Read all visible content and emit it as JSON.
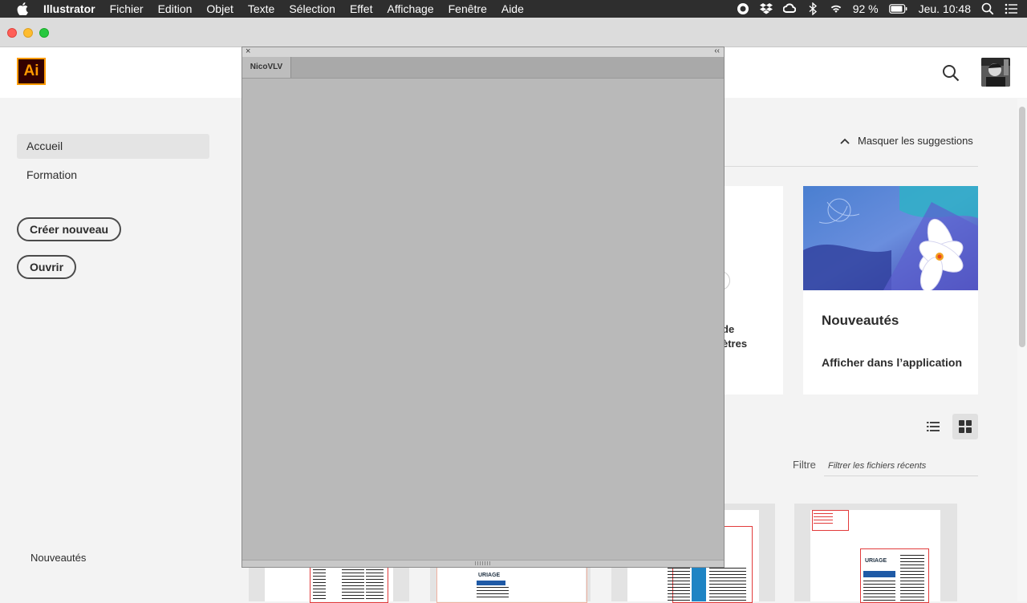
{
  "menubar": {
    "app": "Illustrator",
    "items": [
      "Fichier",
      "Edition",
      "Objet",
      "Texte",
      "Sélection",
      "Effet",
      "Affichage",
      "Fenêtre",
      "Aide"
    ],
    "battery": "92 %",
    "clock": "Jeu. 10:48"
  },
  "app": {
    "logo_text": "Ai"
  },
  "sidebar": {
    "items": [
      {
        "label": "Accueil"
      },
      {
        "label": "Formation"
      }
    ],
    "create_new": "Créer nouveau",
    "open": "Ouvrir",
    "footer": "Nouveautés"
  },
  "main": {
    "hide_suggestions": "Masquer les suggestions",
    "card1_text_line1": "de",
    "card1_text_line2": "ètres",
    "card2_title": "Nouveautés",
    "card2_link": "Afficher dans l’application",
    "filter_label": "Filtre",
    "filter_placeholder": "Filtrer les fichiers récents",
    "thumb_brand": "URIAGE"
  },
  "panel": {
    "tab": "NicoVLV",
    "close": "×",
    "collapse": "‹‹"
  },
  "colors": {
    "ai_bg": "#330000",
    "ai_orange": "#ff9a00",
    "panel_gray": "#b9b9b9"
  }
}
